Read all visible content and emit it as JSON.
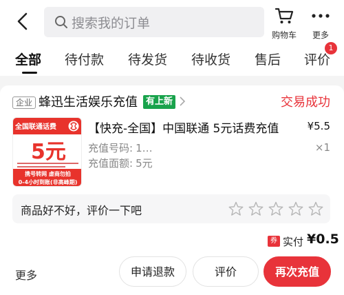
{
  "header": {
    "search_placeholder": "搜索我的订单",
    "cart_label": "购物车",
    "more_label": "更多"
  },
  "tabs": [
    {
      "label": "全部",
      "active": true
    },
    {
      "label": "待付款"
    },
    {
      "label": "待发货"
    },
    {
      "label": "待收货"
    },
    {
      "label": "售后"
    },
    {
      "label": "评价",
      "badge": "1"
    }
  ],
  "order": {
    "shop_tag": "企业",
    "shop_name": "蜂迅生活娱乐充值",
    "shop_new_tag": "有上新",
    "status": "交易成功",
    "status_color": "#e8333a",
    "thumbnail": {
      "title": "全国联通话费",
      "amount": "5元",
      "line1": "携号转网 虚商勿拍",
      "line2": "0-4小时到账(非高峰期)",
      "brand_color": "#e8332c"
    },
    "product_name": "【快充-全国】中国联通 5元话费充值",
    "price": "¥5.5",
    "quantity": "×1",
    "attrs": [
      {
        "label": "充值号码:",
        "value": "1⁠…"
      },
      {
        "label": "充值面额:",
        "value": "5元"
      }
    ],
    "review_prompt": "商品好不好，评价一下吧",
    "rating_stars": 5,
    "rating_filled": 0,
    "coupon_tag": "券",
    "paid_label": "实付",
    "paid_amount": "¥0.5",
    "more_link": "更多",
    "buttons": {
      "refund": "申请退款",
      "review": "评价",
      "recharge": "再次充值"
    }
  }
}
